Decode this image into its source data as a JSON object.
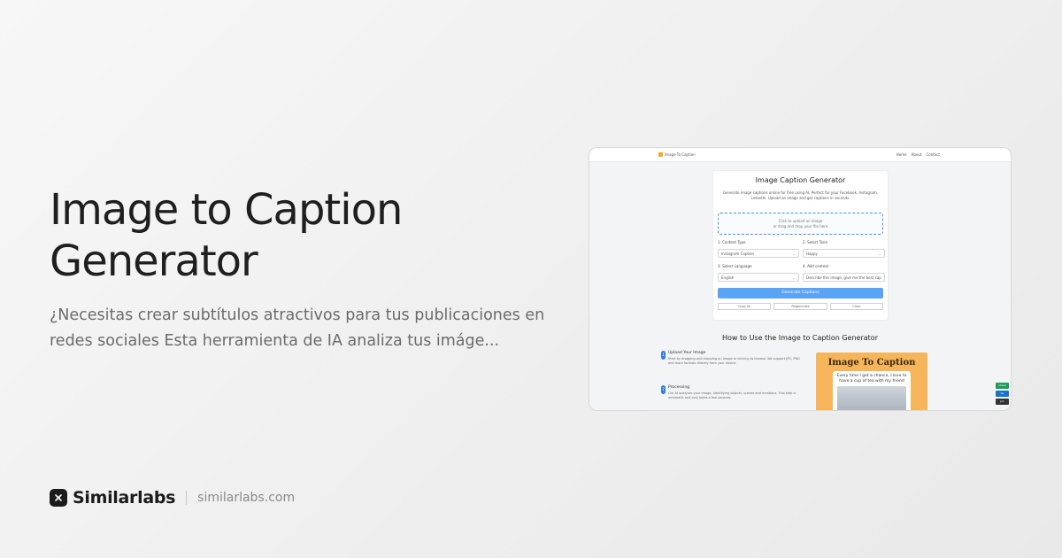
{
  "left": {
    "title": "Image to Caption Generator",
    "description": "¿Necesitas crear subtítulos atractivos para tus publicaciones en redes sociales Esta herramienta de IA analiza tus imáge..."
  },
  "brand": {
    "name": "Similarlabs",
    "url": "similarlabs.com",
    "logo_icon": "similarlabs-logo-icon"
  },
  "screenshot": {
    "nav": {
      "logo_text": "Image To Caption",
      "links": [
        "Home",
        "About",
        "Contact"
      ]
    },
    "panel": {
      "title": "Image Caption Generator",
      "subtitle": "Generate image captions online for free using AI. Perfect for your Facebook, Instagram, LinkedIn. Upload an image and get captions in seconds.",
      "dropzone_line1": "Click to upload an image",
      "dropzone_line2": "or drag and drop your file here",
      "content_type_label": "1. Content Type",
      "content_type_value": "Instagram Caption",
      "style_label": "2. Select Tone",
      "style_value": "Happy",
      "language_label": "3. Select Language",
      "language_value": "English",
      "context_label": "4. Add context",
      "context_placeholder": "Describe this image, give me the best cap",
      "generate_label": "Generate Captions",
      "mini_buttons": [
        "Copy All",
        "Regenerate",
        "Clear"
      ]
    },
    "how": {
      "title": "How to Use the Image to Caption Generator",
      "steps": [
        {
          "num": "1",
          "title": "Upload Your Image",
          "desc": "Start by dragging and dropping an image or clicking to browse. We support JPG, PNG and more formats directly from your device."
        },
        {
          "num": "2",
          "title": "Processing",
          "desc": "Our AI analyzes your image, identifying objects, scenes and emotions. This step is automatic and only takes a few seconds."
        }
      ]
    },
    "poster": {
      "title": "Image To Caption",
      "card_text": "Every time I get a chance, I love to have a cup of tea with my friend"
    },
    "side_badges": [
      {
        "label": "share",
        "color": "#1e9e5a"
      },
      {
        "label": "tw",
        "color": "#1a73c7"
      },
      {
        "label": "pin",
        "color": "#333333"
      }
    ]
  }
}
